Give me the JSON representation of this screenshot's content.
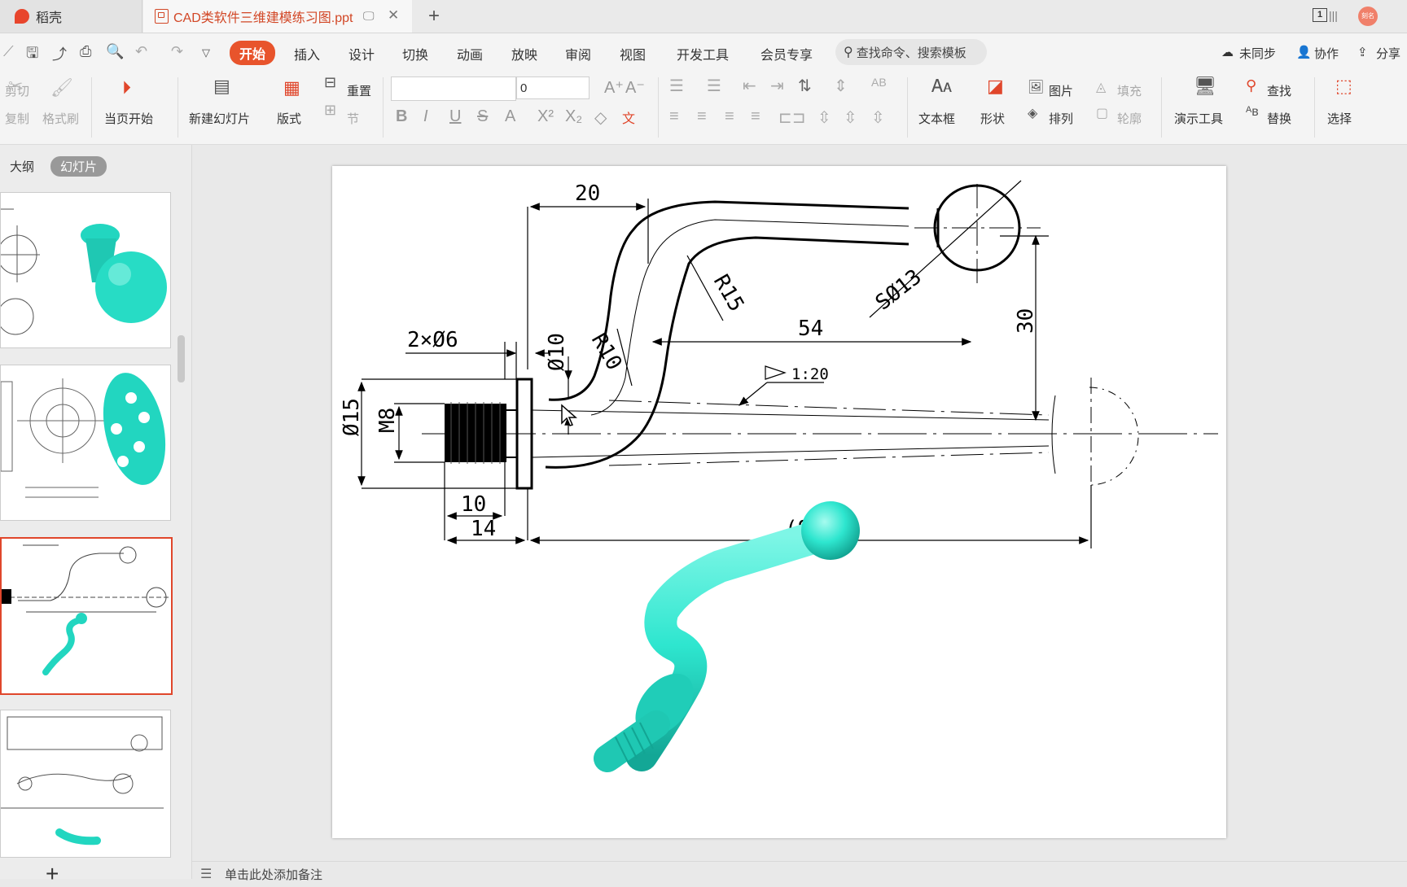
{
  "tabs": {
    "home_label": "稻壳",
    "doc_title": "CAD类软件三维建模练习图.ppt",
    "new_tab": "+",
    "close": "✕",
    "page_num": "1"
  },
  "avatar_text": "刻名",
  "menu": {
    "items": [
      "开始",
      "插入",
      "设计",
      "切换",
      "动画",
      "放映",
      "审阅",
      "视图",
      "开发工具",
      "会员专享"
    ],
    "search_placeholder": "查找命令、搜索模板",
    "right": [
      "未同步",
      "协作",
      "分享"
    ]
  },
  "ribbon": {
    "cut": "剪切",
    "copy": "复制",
    "format_painter": "格式刷",
    "from_current": "当页开始",
    "new_slide": "新建幻灯片",
    "layout": "版式",
    "reset": "重置",
    "section": "节",
    "font_size": "0",
    "textbox": "文本框",
    "shape": "形状",
    "picture": "图片",
    "fill": "填充",
    "arrange": "排列",
    "outline": "轮廓",
    "present_tools": "演示工具",
    "find": "查找",
    "replace": "替换",
    "select": "选择"
  },
  "panel": {
    "outline_tab": "大纲",
    "slides_tab": "幻灯片",
    "add_slide": "+"
  },
  "notes_text": "单击此处添加备注",
  "drawing": {
    "dims": {
      "d20": "20",
      "d2x6": "2×Ø6",
      "d10dia": "Ø10",
      "r10": "R10",
      "r15": "R15",
      "s13": "SØ13",
      "d54": "54",
      "d30": "30",
      "taper": "1:20",
      "d15": "Ø15",
      "m8": "M8",
      "d10": "10",
      "d14": "14",
      "d93": "(93)"
    },
    "model_color": "#2ee6cf"
  }
}
